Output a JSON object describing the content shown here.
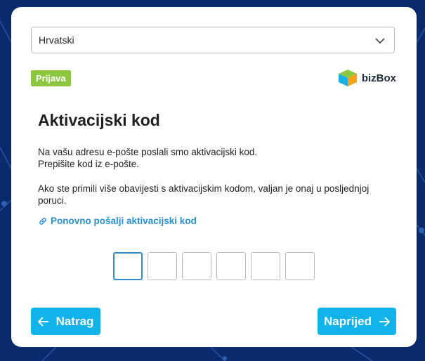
{
  "language_select": {
    "value": "Hrvatski"
  },
  "badge": {
    "label": "Prijava"
  },
  "logo": {
    "text": "bizBox"
  },
  "main": {
    "title": "Aktivacijski kod",
    "line1": "Na vašu adresu e-pošte poslali smo aktivacijski kod.",
    "line2": "Prepišite kod iz e-pošte.",
    "info": "Ako ste primili više obavijesti s aktivacijskim kodom, valjan je onaj u posljednjoj poruci.",
    "resend_label": "Ponovno pošalji aktivacijski kod"
  },
  "code_inputs": [
    "",
    "",
    "",
    "",
    "",
    ""
  ],
  "buttons": {
    "back_label": "Natrag",
    "next_label": "Naprijed"
  },
  "colors": {
    "background": "#0a2a6e",
    "accent": "#11b3ec",
    "badge": "#8dc63f",
    "link": "#2a8fd6"
  },
  "icons": {
    "dropdown": "chevron-down-icon",
    "logo": "cube-logo-icon",
    "resend": "link-icon",
    "back": "arrow-left-icon",
    "next": "arrow-right-icon"
  }
}
